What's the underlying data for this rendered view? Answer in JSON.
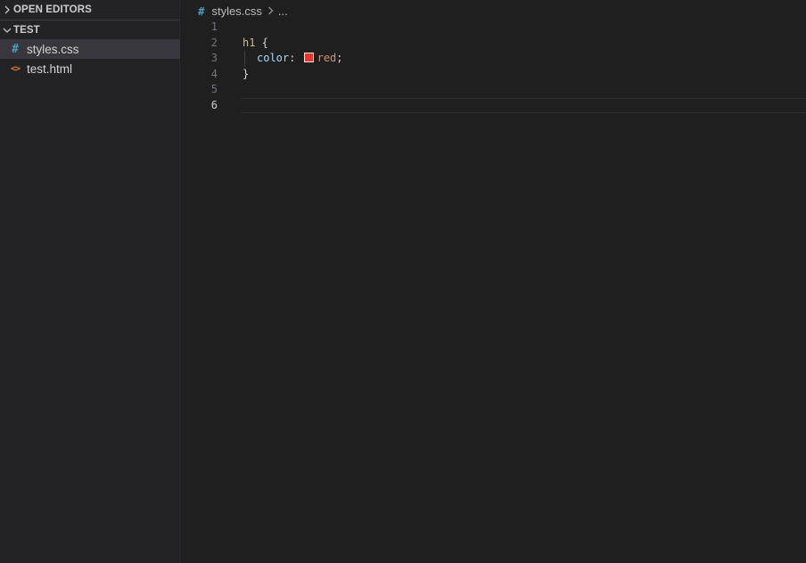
{
  "sidebar": {
    "open_editors_label": "OPEN EDITORS",
    "folder_label": "TEST",
    "files": [
      {
        "name": "styles.css",
        "icon": "#"
      },
      {
        "name": "test.html",
        "icon": "<>"
      }
    ]
  },
  "breadcrumb": {
    "icon": "#",
    "file": "styles.css",
    "ellipsis": "..."
  },
  "code": {
    "line_numbers": [
      "1",
      "2",
      "3",
      "4",
      "5",
      "6"
    ],
    "selector": "h1",
    "open_brace": " {",
    "property": "color",
    "colon": ":",
    "value": "red",
    "semicolon": ";",
    "close_brace": "}",
    "swatch_color": "#e03a2e"
  },
  "colors": {
    "accent_css_icon": "#519aba",
    "accent_html_icon": "#e37933"
  }
}
